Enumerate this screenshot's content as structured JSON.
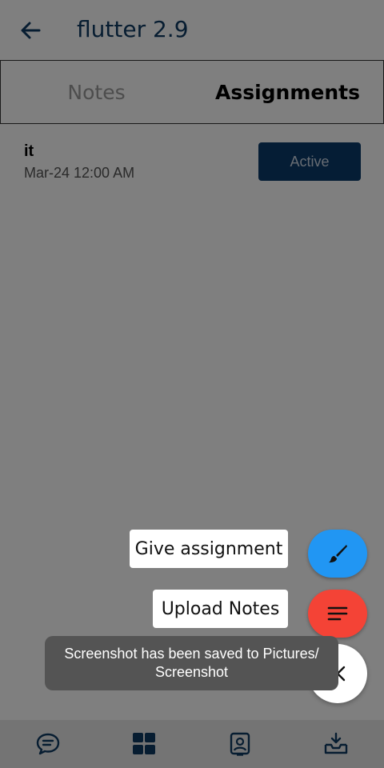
{
  "appbar": {
    "back_icon": "arrow-left-icon",
    "title": "flutter 2.9"
  },
  "tabs": [
    {
      "label": "Notes",
      "selected": false
    },
    {
      "label": "Assignments",
      "selected": true
    }
  ],
  "assignments": [
    {
      "title": "it",
      "date": "Mar-24 12:00 AM",
      "status": "Active"
    }
  ],
  "speed_dial": {
    "give_assignment_label": "Give assignment",
    "give_assignment_icon": "paintbrush-icon",
    "give_assignment_color": "#2196f3",
    "upload_notes_label": "Upload Notes",
    "upload_notes_icon": "notes-lines-icon",
    "upload_notes_color": "#f44336",
    "close_icon": "close-icon"
  },
  "toast": {
    "line1": "Screenshot has been saved to  Pictures/",
    "line2": "Screenshot"
  },
  "bottom_nav": [
    {
      "icon": "chat-bubble-icon"
    },
    {
      "icon": "grid-icon"
    },
    {
      "icon": "contact-card-icon"
    },
    {
      "icon": "inbox-download-icon"
    }
  ]
}
